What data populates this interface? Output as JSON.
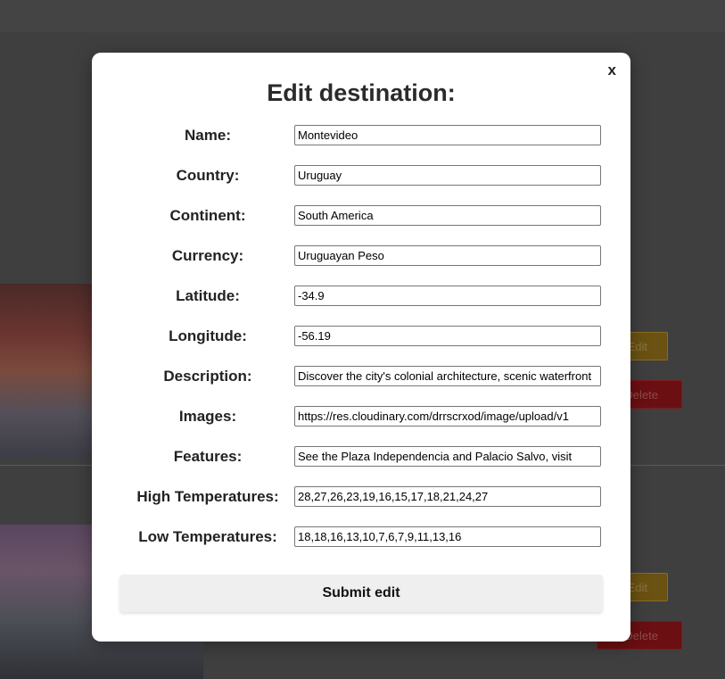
{
  "modal": {
    "close_label": "x",
    "title": "Edit destination:",
    "submit_label": "Submit edit",
    "fields": [
      {
        "label": "Name:",
        "value": "Montevideo"
      },
      {
        "label": "Country:",
        "value": "Uruguay"
      },
      {
        "label": "Continent:",
        "value": "South America"
      },
      {
        "label": "Currency:",
        "value": "Uruguayan Peso"
      },
      {
        "label": "Latitude:",
        "value": "-34.9"
      },
      {
        "label": "Longitude:",
        "value": "-56.19"
      },
      {
        "label": "Description:",
        "value": "Discover the city's colonial architecture, scenic waterfront"
      },
      {
        "label": "Images:",
        "value": "https://res.cloudinary.com/drrscrxod/image/upload/v1"
      },
      {
        "label": "Features:",
        "value": "See the Plaza Independencia and Palacio Salvo, visit"
      },
      {
        "label": "High Temperatures:",
        "value": "28,27,26,23,19,16,15,17,18,21,24,27"
      },
      {
        "label": "Low Temperatures:",
        "value": "18,18,16,13,10,7,6,7,9,11,13,16"
      }
    ]
  },
  "background": {
    "edit_label": "Edit",
    "delete_label": "Delete"
  }
}
